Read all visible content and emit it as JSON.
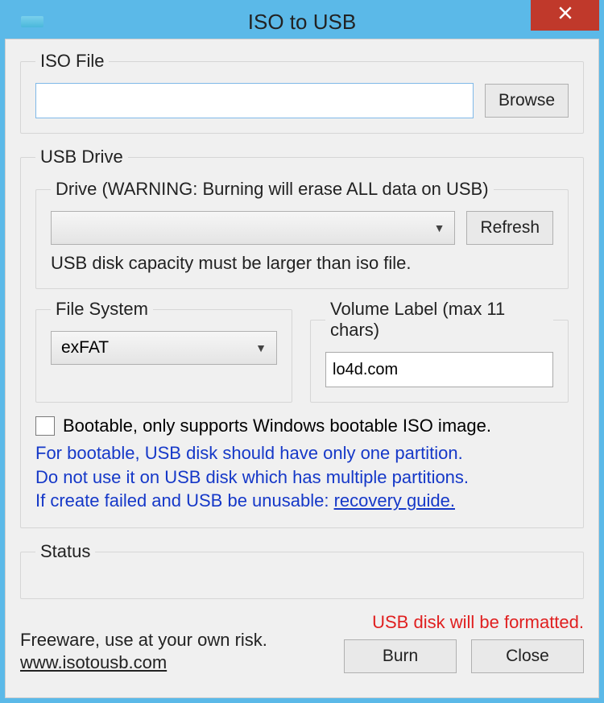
{
  "window": {
    "title": "ISO to USB",
    "close_glyph": "×"
  },
  "iso": {
    "legend": "ISO File",
    "path": "",
    "browse": "Browse"
  },
  "usb": {
    "legend": "USB Drive",
    "drive": {
      "legend": "Drive (WARNING: Burning will erase ALL data on USB)",
      "selected": "",
      "refresh": "Refresh",
      "capacity_note": "USB disk capacity must be larger than iso file."
    },
    "filesystem": {
      "legend": "File System",
      "selected": "exFAT"
    },
    "volume": {
      "legend": "Volume Label (max 11 chars)",
      "value": "lo4d.com"
    },
    "bootable_label": "Bootable, only supports Windows bootable ISO image.",
    "blue1": "For bootable, USB disk should have only one partition.",
    "blue2": "Do not use it on USB disk which has multiple partitions.",
    "blue3_prefix": "If create failed and USB be unusable: ",
    "blue3_link": "recovery guide."
  },
  "status": {
    "legend": "Status"
  },
  "footer": {
    "freeware": "Freeware, use at your own risk.",
    "site": "www.isotousb.com",
    "format_warning": "USB disk will be formatted.",
    "burn": "Burn",
    "close": "Close"
  }
}
